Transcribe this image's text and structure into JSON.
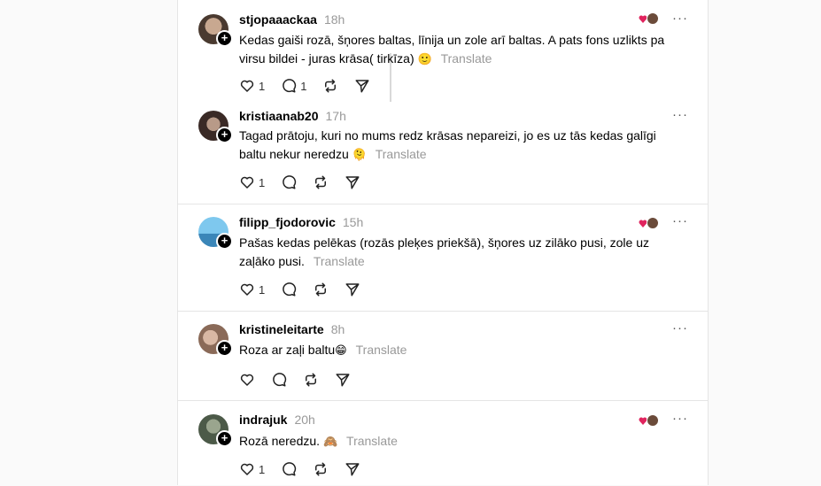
{
  "translate_label": "Translate",
  "posts": [
    {
      "username": "stjopaaackaa",
      "time": "18h",
      "text": "Kedas gaiši rozā, šņores baltas, līnija un zole arī baltas. A pats fons uzlikts pa virsu bildei - juras krāsa( tirkīza)",
      "emoji": "🙂",
      "likes": "1",
      "replies": "1"
    },
    {
      "username": "kristiaanab20",
      "time": "17h",
      "text": "Tagad prātoju, kuri no mums redz krāsas nepareizi, jo es uz tās kedas galīgi baltu nekur neredzu",
      "emoji": "🫠",
      "likes": "1"
    },
    {
      "username": "filipp_fjodorovic",
      "time": "15h",
      "text": "Pašas kedas pelēkas (rozās pleķes priekšā), šņores uz zilāko pusi, zole uz zaļāko pusi.",
      "likes": "1"
    },
    {
      "username": "kristineleitarte",
      "time": "8h",
      "text": "Roza ar zaļi baltu",
      "emoji": "😁"
    },
    {
      "username": "indrajuk",
      "time": "20h",
      "text": "Rozā neredzu.",
      "emoji": "🙈",
      "likes": "1"
    }
  ]
}
